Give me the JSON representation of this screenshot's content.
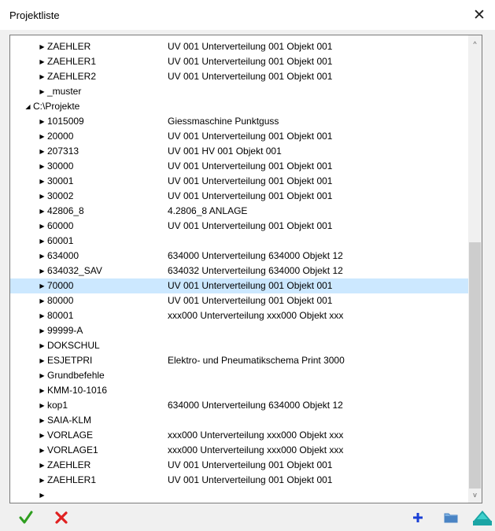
{
  "window": {
    "title": "Projektliste",
    "close_glyph": "✕"
  },
  "tree": {
    "rows": [
      {
        "level": 1,
        "expander": "collapsed",
        "name": "ZAEHLER",
        "desc": "UV 001 Unterverteilung 001 Objekt 001"
      },
      {
        "level": 1,
        "expander": "collapsed",
        "name": "ZAEHLER1",
        "desc": "UV 001 Unterverteilung 001 Objekt 001"
      },
      {
        "level": 1,
        "expander": "collapsed",
        "name": "ZAEHLER2",
        "desc": "UV 001 Unterverteilung 001 Objekt 001"
      },
      {
        "level": 1,
        "expander": "collapsed",
        "name": "_muster",
        "desc": ""
      },
      {
        "level": 0,
        "expander": "expanded",
        "name": "C:\\Projekte",
        "desc": ""
      },
      {
        "level": 1,
        "expander": "collapsed",
        "name": "1015009",
        "desc": "Giessmaschine Punktguss"
      },
      {
        "level": 1,
        "expander": "collapsed",
        "name": "20000",
        "desc": "UV 001 Unterverteilung 001 Objekt 001"
      },
      {
        "level": 1,
        "expander": "collapsed",
        "name": "207313",
        "desc": "UV 001 HV 001 Objekt 001"
      },
      {
        "level": 1,
        "expander": "collapsed",
        "name": "30000",
        "desc": "UV 001 Unterverteilung 001 Objekt 001"
      },
      {
        "level": 1,
        "expander": "collapsed",
        "name": "30001",
        "desc": "UV 001 Unterverteilung 001 Objekt 001"
      },
      {
        "level": 1,
        "expander": "collapsed",
        "name": "30002",
        "desc": "UV 001 Unterverteilung 001 Objekt 001"
      },
      {
        "level": 1,
        "expander": "collapsed",
        "name": "42806_8",
        "desc": "4.2806_8 ANLAGE"
      },
      {
        "level": 1,
        "expander": "collapsed",
        "name": "60000",
        "desc": "UV 001 Unterverteilung 001 Objekt 001"
      },
      {
        "level": 1,
        "expander": "collapsed",
        "name": "60001",
        "desc": ""
      },
      {
        "level": 1,
        "expander": "collapsed",
        "name": "634000",
        "desc": "634000 Unterverteilung 634000 Objekt 12"
      },
      {
        "level": 1,
        "expander": "collapsed",
        "name": "634032_SAV",
        "desc": "634032 Unterverteilung 634000 Objekt 12"
      },
      {
        "level": 1,
        "expander": "collapsed",
        "name": "70000",
        "desc": "UV 001 Unterverteilung 001 Objekt 001",
        "selected": true
      },
      {
        "level": 1,
        "expander": "collapsed",
        "name": "80000",
        "desc": "UV 001 Unterverteilung 001 Objekt 001"
      },
      {
        "level": 1,
        "expander": "collapsed",
        "name": "80001",
        "desc": "xxx000 Unterverteilung xxx000 Objekt xxx"
      },
      {
        "level": 1,
        "expander": "collapsed",
        "name": "99999-A",
        "desc": ""
      },
      {
        "level": 1,
        "expander": "collapsed",
        "name": "DOKSCHUL",
        "desc": ""
      },
      {
        "level": 1,
        "expander": "collapsed",
        "name": "ESJETPRI",
        "desc": "Elektro- und Pneumatikschema Print 3000"
      },
      {
        "level": 1,
        "expander": "collapsed",
        "name": "Grundbefehle",
        "desc": ""
      },
      {
        "level": 1,
        "expander": "collapsed",
        "name": "KMM-10-1016",
        "desc": ""
      },
      {
        "level": 1,
        "expander": "collapsed",
        "name": "kop1",
        "desc": "634000 Unterverteilung 634000 Objekt 12"
      },
      {
        "level": 1,
        "expander": "collapsed",
        "name": "SAIA-KLM",
        "desc": ""
      },
      {
        "level": 1,
        "expander": "collapsed",
        "name": "VORLAGE",
        "desc": "xxx000 Unterverteilung xxx000 Objekt xxx"
      },
      {
        "level": 1,
        "expander": "collapsed",
        "name": "VORLAGE1",
        "desc": "xxx000 Unterverteilung xxx000 Objekt xxx"
      },
      {
        "level": 1,
        "expander": "collapsed",
        "name": "ZAEHLER",
        "desc": "UV 001 Unterverteilung 001 Objekt 001"
      },
      {
        "level": 1,
        "expander": "collapsed",
        "name": "ZAEHLER1",
        "desc": "UV 001 Unterverteilung 001 Objekt 001"
      },
      {
        "level": 1,
        "expander": "collapsed",
        "name": "",
        "desc": ""
      }
    ]
  },
  "scrollbar": {
    "up_glyph": "^",
    "down_glyph": "v"
  },
  "toolbar": {
    "ok_icon": "green-checkmark-icon",
    "cancel_icon": "red-x-icon",
    "add_icon": "blue-plus-icon",
    "folder_icon": "folder-icon",
    "up_icon": "teal-triangle-up-icon",
    "colors": {
      "ok": "#2e9e1f",
      "cancel": "#e02020",
      "add": "#1a3fd6",
      "folder": "#4a84c4",
      "up": "#1aa5a5"
    }
  }
}
